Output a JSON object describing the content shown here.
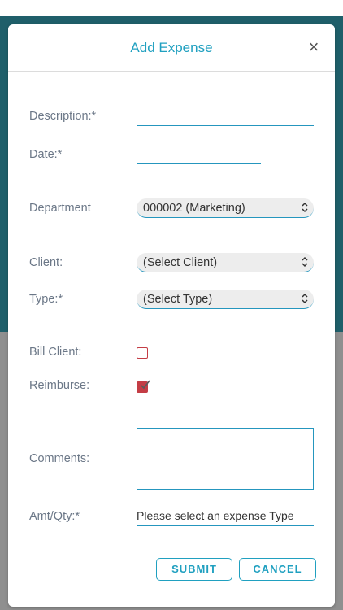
{
  "modal": {
    "title": "Add Expense",
    "close_glyph": "×"
  },
  "form": {
    "description_label": "Description:*",
    "description_value": "",
    "date_label": "Date:*",
    "date_value": "",
    "department_label": "Department",
    "department_value": "000002 (Marketing)",
    "client_label": "Client:",
    "client_value": "(Select Client)",
    "type_label": "Type:*",
    "type_value": "(Select Type)",
    "bill_client_label": "Bill Client:",
    "bill_client_checked": false,
    "reimburse_label": "Reimburse:",
    "reimburse_checked": true,
    "comments_label": "Comments:",
    "comments_value": "",
    "amt_label": "Amt/Qty:*",
    "amt_value": "Please select an expense Type"
  },
  "buttons": {
    "submit": "SUBMIT",
    "cancel": "CANCEL"
  },
  "colors": {
    "accent": "#20a0c0",
    "checkbox": "#c43d45",
    "backdrop_top": "#1f5f6a",
    "backdrop_bottom": "#8f8f8f"
  },
  "icons": {
    "close": "close-icon",
    "select_arrows": "chevron-up-down-icon",
    "check": "check-icon"
  }
}
